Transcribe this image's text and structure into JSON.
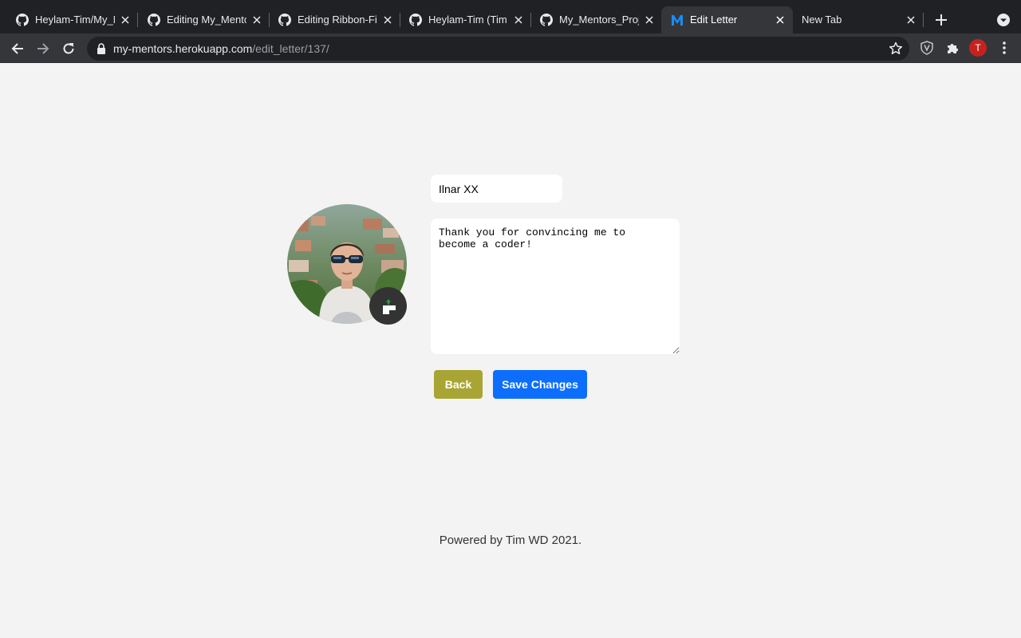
{
  "browser": {
    "tabs": [
      {
        "title": "Heylam-Tim/My_M",
        "icon": "github-icon"
      },
      {
        "title": "Editing My_Mento",
        "icon": "github-icon"
      },
      {
        "title": "Editing Ribbon-Fi",
        "icon": "github-icon"
      },
      {
        "title": "Heylam-Tim (Tim",
        "icon": "github-icon"
      },
      {
        "title": "My_Mentors_Proje",
        "icon": "github-icon"
      },
      {
        "title": "Edit Letter",
        "icon": "mentors-m-icon",
        "active": true
      },
      {
        "title": "New Tab",
        "icon": ""
      }
    ],
    "url_host": "my-mentors.herokuapp.com",
    "url_path": "/edit_letter/137/",
    "profile_initial": "T"
  },
  "form": {
    "name_value": "Ilnar XX",
    "letter_text": "Thank you for convincing me to\nbecome a coder!",
    "back_label": "Back",
    "save_label": "Save Changes"
  },
  "footer": {
    "text": "Powered by Tim WD 2021."
  },
  "colors": {
    "page_background": "#f3f3f3",
    "back_button": "#a9a535",
    "save_button": "#0d6efd",
    "active_tab_m": "#1a8cff"
  }
}
